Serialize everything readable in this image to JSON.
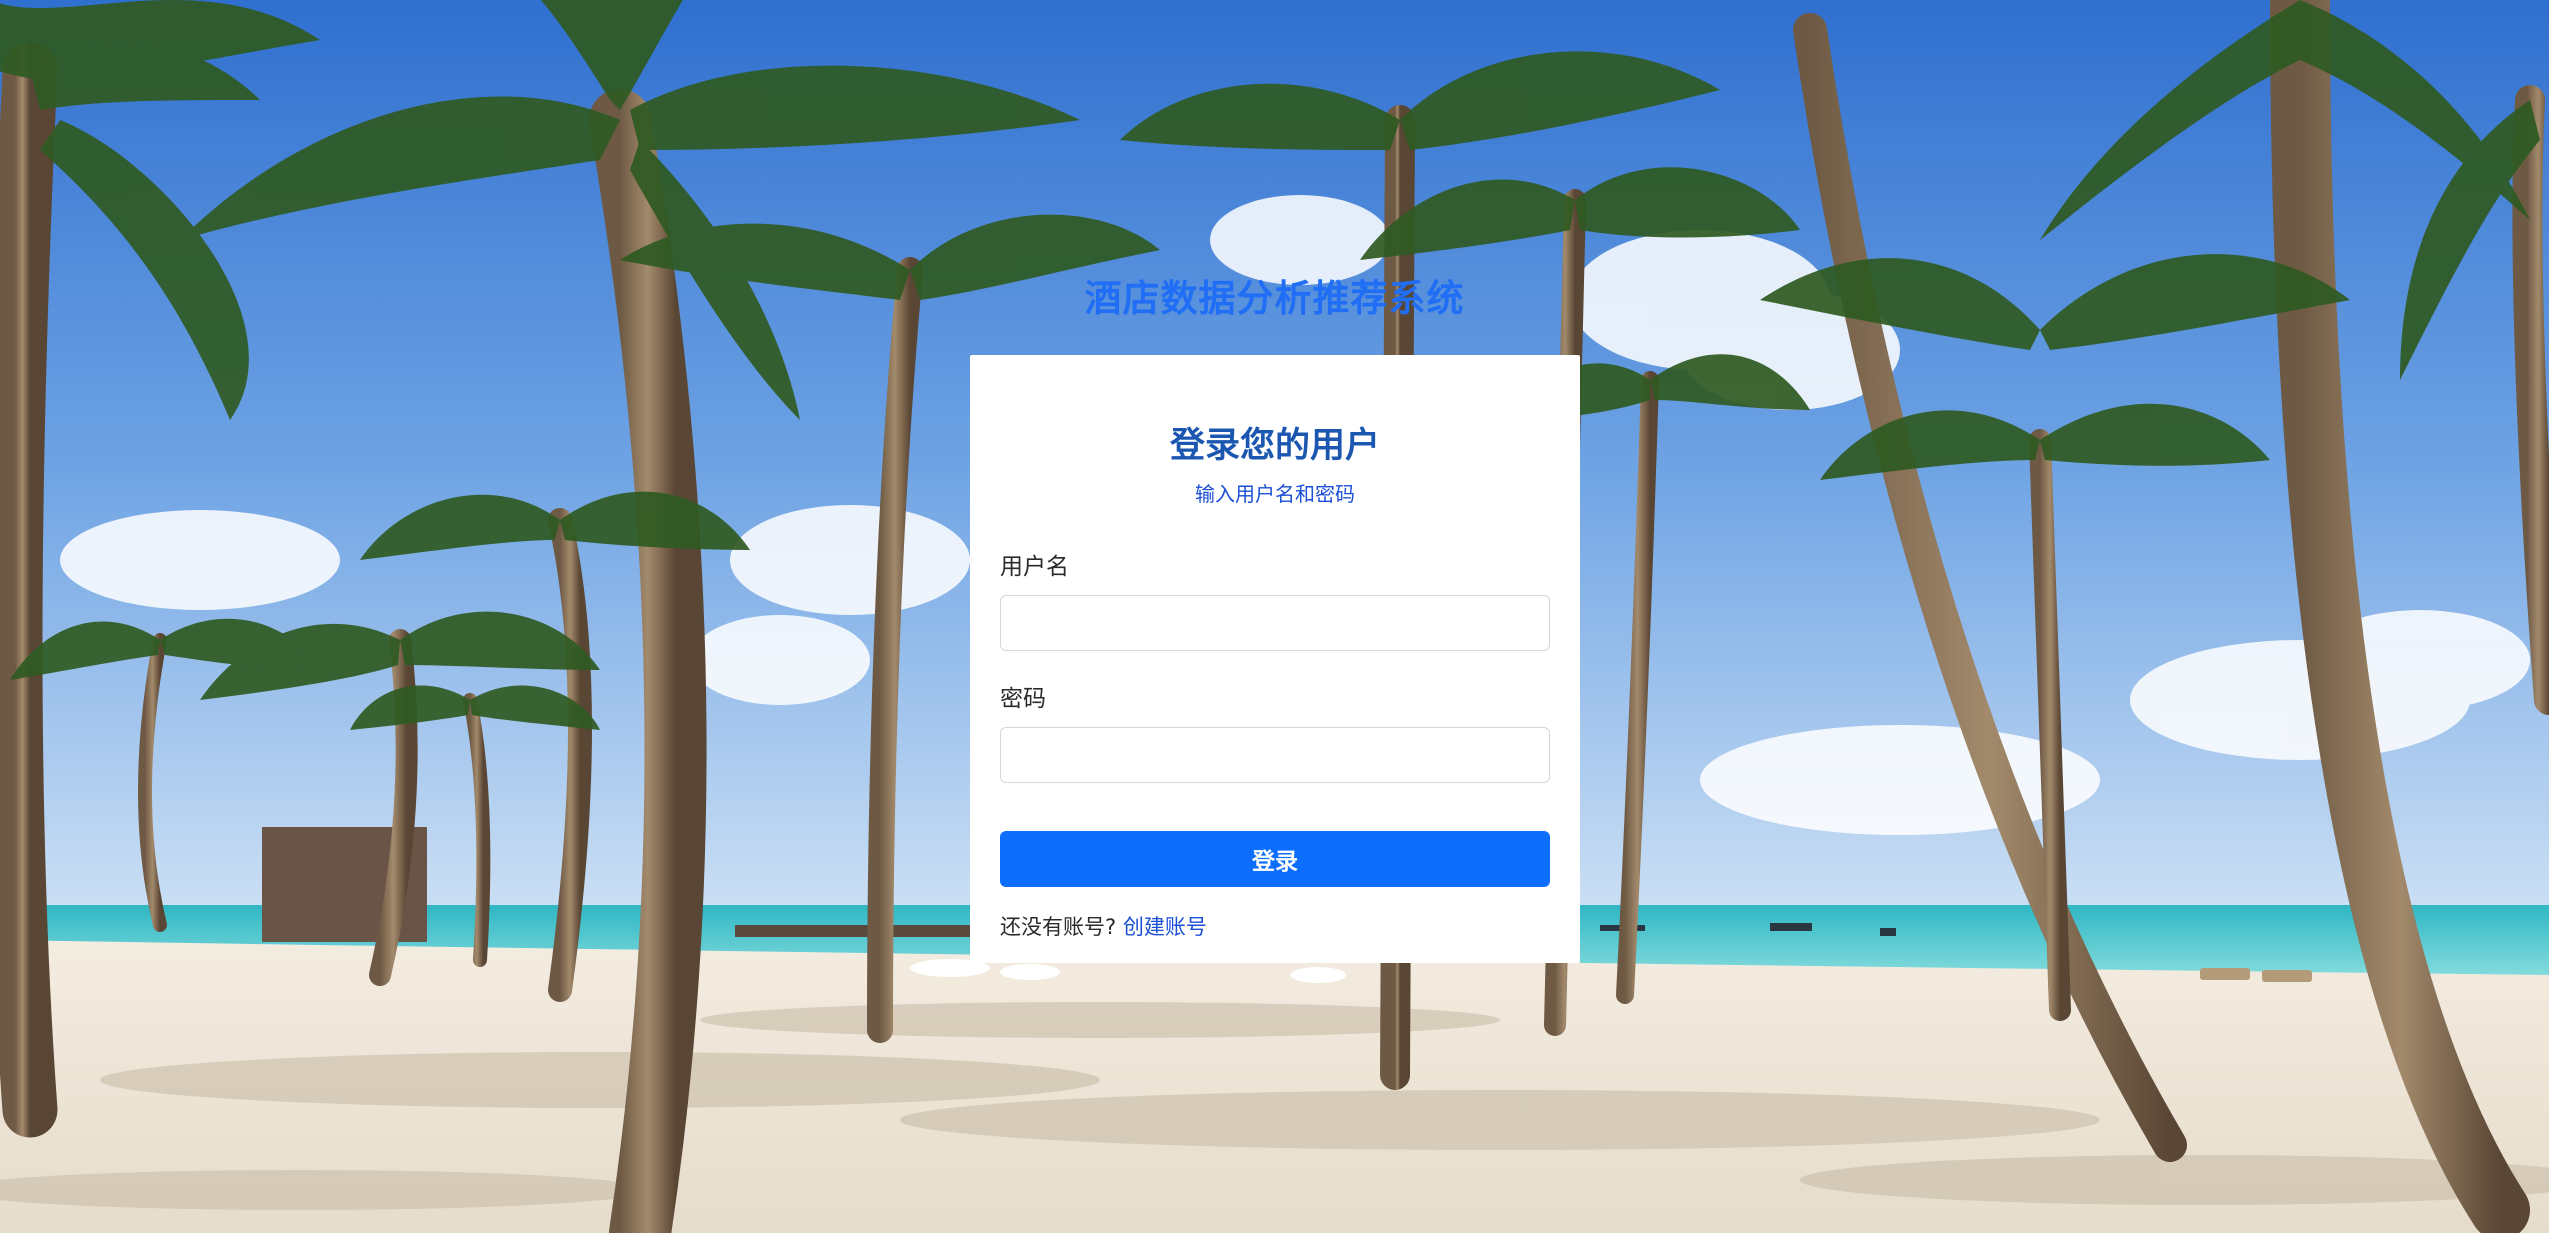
{
  "app": {
    "title": "酒店数据分析推荐系统"
  },
  "login": {
    "heading": "登录您的用户",
    "subheading": "输入用户名和密码",
    "username_label": "用户名",
    "username_value": "",
    "password_label": "密码",
    "password_value": "",
    "submit_label": "登录",
    "signup_prompt": "还没有账号?",
    "signup_link": "创建账号"
  },
  "colors": {
    "title": "#1f6ef5",
    "heading": "#1b56b0",
    "link": "#1b4fd6",
    "button": "#0d6efd",
    "sky": "#3f7fd6",
    "sea": "#3cc6cc",
    "sand": "#efe6d6"
  }
}
